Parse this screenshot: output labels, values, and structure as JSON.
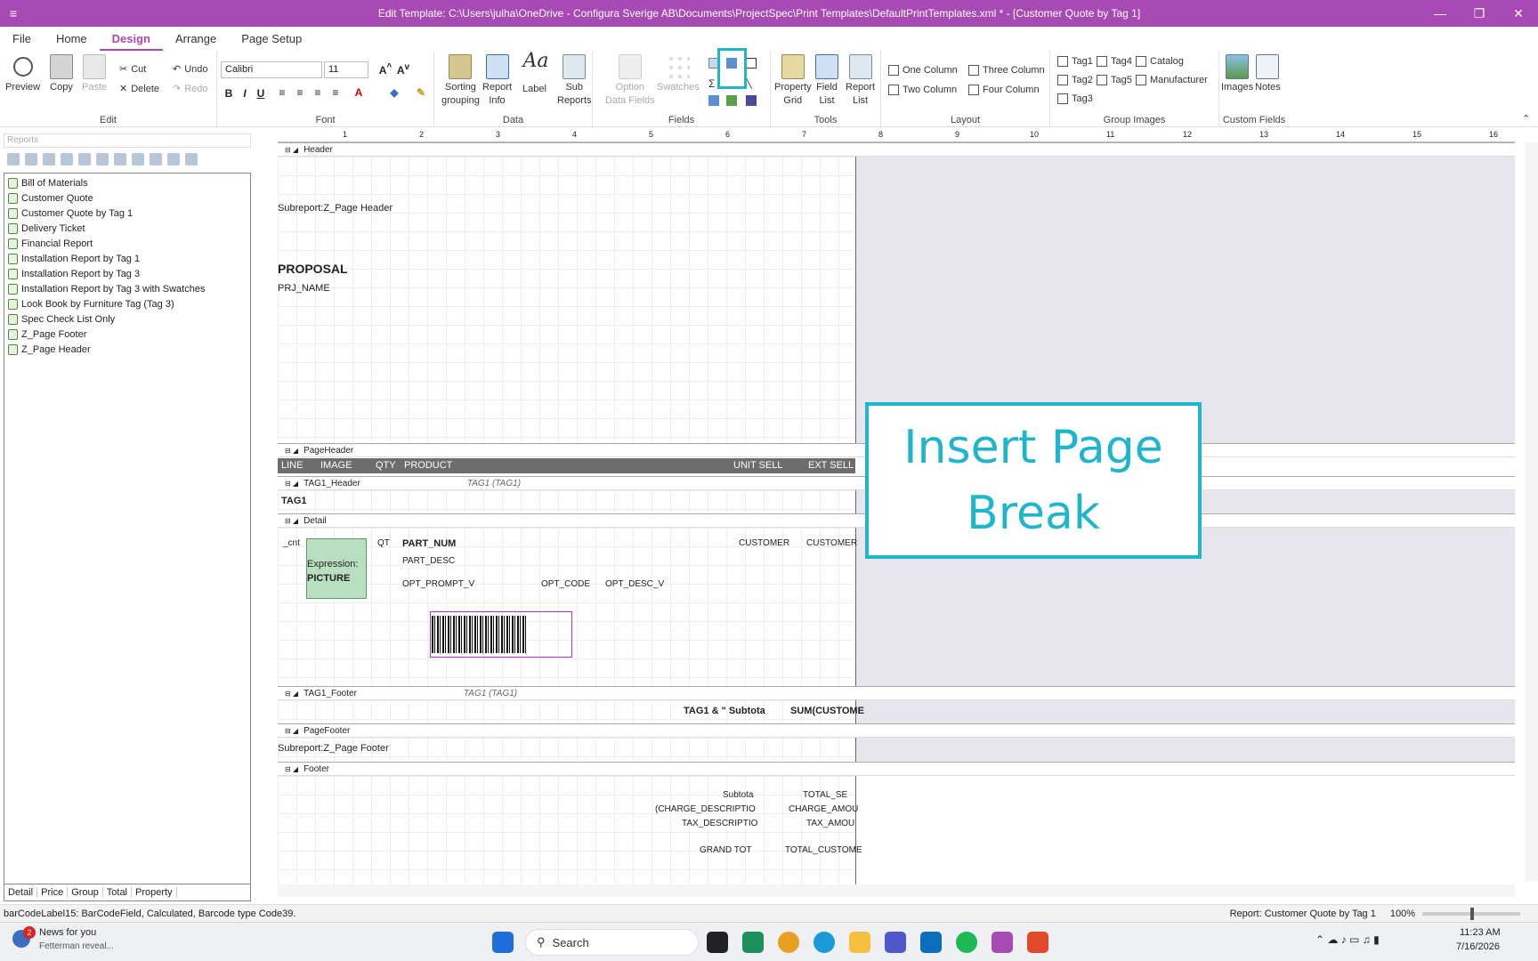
{
  "window": {
    "title": "Edit Template:  C:\\Users\\julha\\OneDrive - Configura Sverige AB\\Documents\\ProjectSpec\\Print Templates\\DefaultPrintTemplates.xml * - [Customer Quote by Tag 1]",
    "controls": [
      "—",
      "❐",
      "✕"
    ]
  },
  "menu": {
    "items": [
      "File",
      "Home",
      "Design",
      "Arrange",
      "Page Setup"
    ],
    "active": "Design"
  },
  "ribbon": {
    "groups": {
      "edit": "Edit",
      "font": "Font",
      "data": "Data",
      "fields": "Fields",
      "tools": "Tools",
      "layout": "Layout",
      "group_images": "Group Images",
      "custom_fields": "Custom Fields"
    },
    "buttons": {
      "preview": "Preview",
      "copy": "Copy",
      "paste": "Paste",
      "cut": "Cut",
      "delete": "Delete",
      "undo": "Undo",
      "redo": "Redo",
      "sorting_a": "Sorting",
      "sorting_b": "grouping",
      "report_info_a": "Report",
      "report_info_b": "Info",
      "label": "Label",
      "sub_reports_a": "Sub",
      "sub_reports_b": "Reports",
      "option_a": "Option",
      "option_b": "Data Fields",
      "swatches": "Swatches",
      "property_grid_a": "Property",
      "property_grid_b": "Grid",
      "field_list_a": "Field",
      "field_list_b": "List",
      "report_list_a": "Report",
      "report_list_b": "List",
      "one_column": "One Column",
      "two_column": "Two Column",
      "three_column": "Three Column",
      "four_column": "Four Column",
      "tag1": "Tag1",
      "tag2": "Tag2",
      "tag3": "Tag3",
      "tag4": "Tag4",
      "tag5": "Tag5",
      "catalog": "Catalog",
      "manufacturer": "Manufacturer",
      "images": "Images",
      "notes": "Notes"
    },
    "font_name": "Calibri",
    "font_size": "11"
  },
  "left_pane": {
    "header": "Reports",
    "reports": [
      "Bill of Materials",
      "Customer Quote",
      "Customer Quote by Tag 1",
      "Delivery Ticket",
      "Financial Report",
      "Installation Report by Tag 1",
      "Installation Report by Tag 3",
      "Installation Report by Tag 3 with Swatches",
      "Look Book by Furniture Tag (Tag 3)",
      "Spec Check List Only",
      "Z_Page Footer",
      "Z_Page Header"
    ],
    "tabs": [
      "Detail",
      "Price",
      "Group",
      "Total",
      "Property"
    ]
  },
  "ruler": [
    "1",
    "2",
    "3",
    "4",
    "5",
    "6",
    "7",
    "8",
    "9",
    "10",
    "11",
    "12",
    "13",
    "14",
    "15",
    "16"
  ],
  "bands": {
    "header": "Header",
    "page_header": "PageHeader",
    "tag1_header": "TAG1_Header",
    "tag1_header_note": "TAG1 (TAG1)",
    "detail": "Detail",
    "tag1_footer": "TAG1_Footer",
    "tag1_footer_note": "TAG1 (TAG1)",
    "page_footer": "PageFooter",
    "footer": "Footer"
  },
  "fields": {
    "subreport_header": "Subreport:Z_Page Header",
    "proposal": "PROPOSAL",
    "prj_name": "PRJ_NAME",
    "col_line": "LINE",
    "col_image": "IMAGE",
    "col_qty": "QTY",
    "col_product": "PRODUCT",
    "col_unit_sell": "UNIT SELL",
    "col_ext_sell": "EXT SELL",
    "tag1": "TAG1",
    "cnt": "_cnt",
    "expression": "Expression:",
    "picture": "PICTURE",
    "qt": "QT",
    "part_num": "PART_NUM",
    "part_desc": "PART_DESC",
    "customer1": "CUSTOMER",
    "customer2": "CUSTOMER",
    "opt_prompt": "OPT_PROMPT_V",
    "opt_code": "OPT_CODE",
    "opt_desc": "OPT_DESC_V",
    "subtotal_label": "TAG1 & \"  Subtota",
    "sum_customer": "SUM(CUSTOME",
    "subreport_footer": "Subreport:Z_Page Footer",
    "subtotal": "Subtota",
    "total_se": "TOTAL_SE",
    "charge_desc": "(CHARGE_DESCRIPTIO",
    "charge_amt": "CHARGE_AMOU",
    "tax_desc": "TAX_DESCRIPTIO",
    "tax_amt": "TAX_AMOU",
    "grand_tot": "GRAND TOT",
    "total_customer": "TOTAL_CUSTOME"
  },
  "callout": {
    "line1": "Insert Page",
    "line2": "Break",
    "color": "#1fb5cc"
  },
  "status": {
    "left": "barCodeLabel15: BarCodeField, Calculated, Barcode type Code39.",
    "report": "Report: Customer Quote by Tag 1",
    "zoom": "100%"
  },
  "taskbar": {
    "news_title": "News for you",
    "news_sub": "Fetterman reveal...",
    "news_badge": "2",
    "search": "Search",
    "time": "11:23 AM",
    "date": "7/16/2026"
  },
  "colors": {
    "accent": "#a84ab4",
    "highlight": "#1fb5cc"
  }
}
